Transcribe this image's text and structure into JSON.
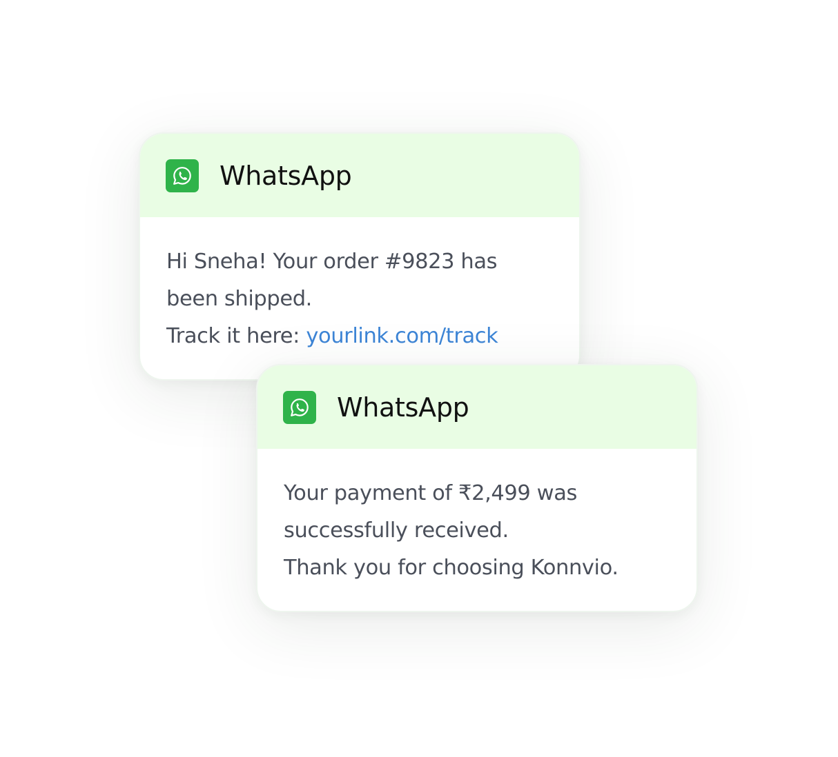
{
  "notifications": [
    {
      "app_name": "WhatsApp",
      "icon": "whatsapp-icon",
      "lines": {
        "line1": "Hi Sneha! Your order #9823 has",
        "line2": "been shipped.",
        "line3_prefix": "Track it here: ",
        "line3_link": "yourlink.com/track"
      }
    },
    {
      "app_name": "WhatsApp",
      "icon": "whatsapp-icon",
      "lines": {
        "line1": "Your payment of ₹2,499 was",
        "line2": "successfully received.",
        "line3": "Thank you for choosing Konnvio."
      }
    }
  ],
  "colors": {
    "header_bg": "#e9fde4",
    "whatsapp_green": "#2fb34a",
    "link": "#3d85d6",
    "body_text": "#4a4f5a",
    "title_text": "#111111"
  }
}
